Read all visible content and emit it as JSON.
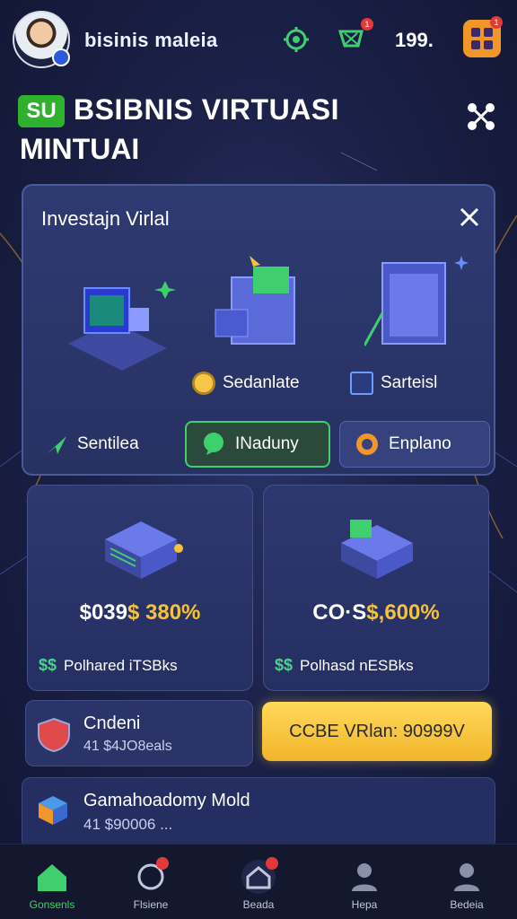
{
  "header": {
    "username": "bisinis maleia",
    "coins": "199.",
    "scan_icon": "gear-scan-icon",
    "cart_icon": "cart-icon",
    "menu_icon": "grid-menu-icon",
    "notif_badge": "1"
  },
  "title": {
    "badge": "SU",
    "line1": "BSIBNIS VIRTUASI",
    "line2": "MINTUAI",
    "share_icon": "share-icon"
  },
  "panel": {
    "title": "Investajn Virlal",
    "assets": [
      {
        "label": "Sedanlate",
        "icon": "coin-icon"
      },
      {
        "label": "Sarteisl",
        "icon": "box-icon"
      }
    ],
    "actions": [
      {
        "label": "Sentilea",
        "icon": "send-icon"
      },
      {
        "label": "INaduny",
        "icon": "chat-icon"
      },
      {
        "label": "Enplano",
        "icon": "target-icon"
      }
    ]
  },
  "cards": [
    {
      "value_prefix": "$039",
      "value_highlight": "$ 380%",
      "sub": "Polhared iTSBks"
    },
    {
      "value_prefix": "CO·S",
      "value_highlight": "$,600%",
      "sub": "Polhasd nESBks"
    }
  ],
  "quest": {
    "title": "Cndeni",
    "sub": "41 $4JO8eals"
  },
  "cta": {
    "label": "CCBE VRlan: 90999V"
  },
  "wide_card": {
    "title": "Gamahoadomy Mold",
    "sub": "41 $90006 ..."
  },
  "nav": [
    {
      "label": "Gonsenls",
      "icon": "home-icon",
      "active": true
    },
    {
      "label": "Flsiene",
      "icon": "refresh-icon"
    },
    {
      "label": "Beada",
      "icon": "store-icon"
    },
    {
      "label": "Hepa",
      "icon": "person-icon"
    },
    {
      "label": "Bedeia",
      "icon": "profile-icon"
    }
  ],
  "colors": {
    "accent_green": "#3fcf6f",
    "accent_yellow": "#f5c23a",
    "background": "#1b2148"
  }
}
